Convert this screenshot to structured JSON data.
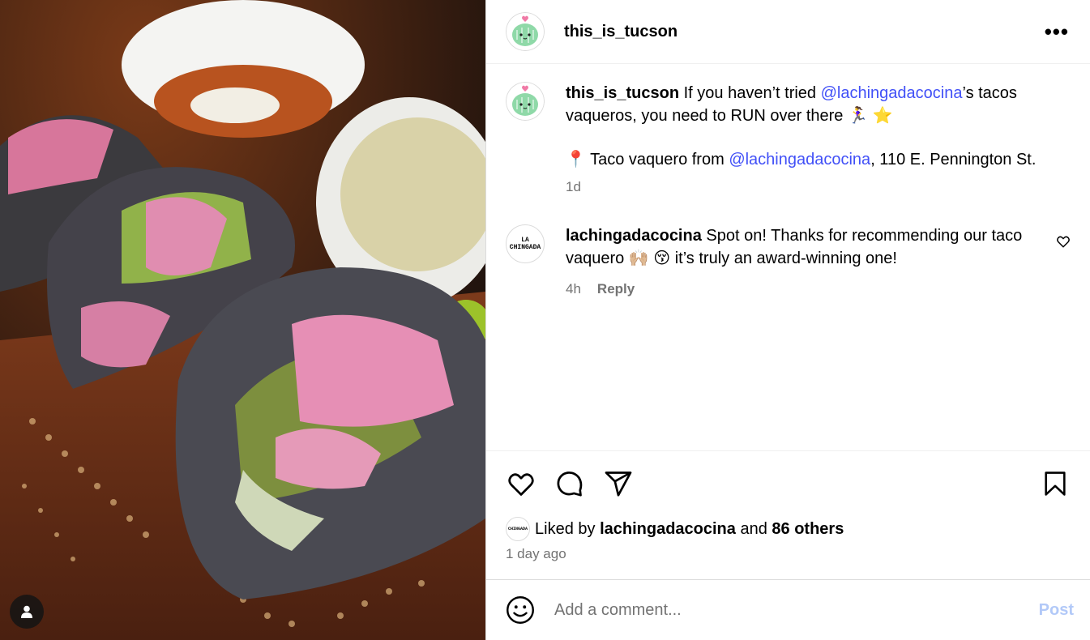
{
  "post": {
    "username": "this_is_tucson",
    "caption_prefix": "If you haven’t tried",
    "caption_mention": "@lachingadacocina",
    "caption_suffix": "’s tacos vaqueros, you need to RUN over there",
    "caption_emojis": "🏃‍♀️ ⭐",
    "location_pin": "📍",
    "location_prefix": "Taco vaquero from",
    "location_mention": "@lachingadacocina",
    "location_suffix": ", 110 E. Pennington St.",
    "age": "1d"
  },
  "reply_comment": {
    "username": "lachingadacocina",
    "text_a": "Spot on! Thanks for recommending our taco vaquero",
    "emojis": "🙌🏼 😚",
    "text_b": "it’s truly an award-winning one!",
    "age": "4h",
    "reply_label": "Reply",
    "logo_line1": "LA",
    "logo_line2": "CHINGADA"
  },
  "likes": {
    "prefix": "Liked by",
    "user": "lachingadacocina",
    "middle": "and",
    "others": "86 others",
    "date": "1 day ago"
  },
  "add_comment": {
    "placeholder": "Add a comment...",
    "post_label": "Post"
  },
  "more_glyph": "•••",
  "colors": {
    "mention": "#4150f7",
    "post_disabled": "#b2c9f8",
    "secondary_text": "#737373"
  },
  "icons": [
    "heart-icon",
    "comment-icon",
    "share-icon",
    "bookmark-icon",
    "emoji-icon",
    "more-icon",
    "user-tag-icon"
  ]
}
